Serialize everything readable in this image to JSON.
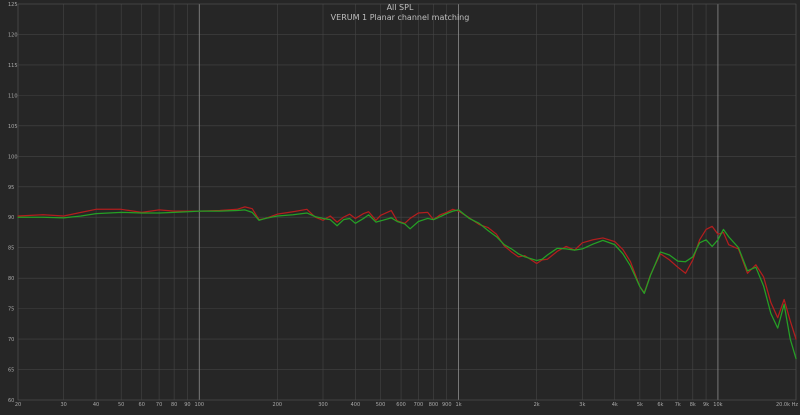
{
  "chart_data": {
    "type": "line",
    "title": "All SPL",
    "subtitle": "VERUM 1 Planar channel matching",
    "xlabel": "",
    "ylabel": "",
    "xscale": "log",
    "xlim": [
      20,
      20000
    ],
    "ylim": [
      60,
      125
    ],
    "grid": true,
    "legend": "none",
    "y_ticks": [
      60,
      65,
      70,
      75,
      80,
      85,
      90,
      95,
      100,
      105,
      110,
      115,
      120,
      125
    ],
    "y_tick_labels": [
      "60",
      "65",
      "70",
      "75",
      "80",
      "85",
      "90",
      "95",
      "100",
      "105",
      "110",
      "115",
      "120",
      "125"
    ],
    "x_ticks": [
      20,
      30,
      40,
      50,
      60,
      70,
      80,
      90,
      100,
      200,
      300,
      400,
      500,
      600,
      700,
      800,
      900,
      1000,
      2000,
      3000,
      4000,
      5000,
      6000,
      7000,
      8000,
      9000,
      10000,
      20000
    ],
    "x_tick_labels": [
      "20",
      "30",
      "40",
      "50",
      "60",
      "70",
      "80",
      "90",
      "100",
      "200",
      "300",
      "400",
      "500",
      "600",
      "700",
      "800",
      "900",
      "1k",
      "2k",
      "3k",
      "4k",
      "5k",
      "6k",
      "7k",
      "8k",
      "9k",
      "10k",
      "20.0k Hz"
    ],
    "major_x_lines": [
      100,
      1000,
      10000
    ],
    "series": [
      {
        "color": "#b31e1e",
        "points": [
          [
            20,
            90.2
          ],
          [
            25,
            90.4
          ],
          [
            30,
            90.2
          ],
          [
            35,
            90.8
          ],
          [
            40,
            91.3
          ],
          [
            50,
            91.3
          ],
          [
            60,
            90.8
          ],
          [
            70,
            91.2
          ],
          [
            80,
            91.0
          ],
          [
            90,
            91.0
          ],
          [
            100,
            91.0
          ],
          [
            120,
            91.1
          ],
          [
            140,
            91.3
          ],
          [
            150,
            91.7
          ],
          [
            160,
            91.4
          ],
          [
            170,
            89.6
          ],
          [
            180,
            89.8
          ],
          [
            200,
            90.5
          ],
          [
            230,
            90.9
          ],
          [
            260,
            91.3
          ],
          [
            280,
            90.0
          ],
          [
            300,
            89.5
          ],
          [
            320,
            90.2
          ],
          [
            340,
            89.2
          ],
          [
            360,
            90.0
          ],
          [
            380,
            90.5
          ],
          [
            400,
            89.8
          ],
          [
            430,
            90.6
          ],
          [
            450,
            90.9
          ],
          [
            480,
            89.5
          ],
          [
            500,
            90.3
          ],
          [
            550,
            91.1
          ],
          [
            580,
            89.4
          ],
          [
            620,
            89.0
          ],
          [
            650,
            89.8
          ],
          [
            700,
            90.7
          ],
          [
            760,
            90.8
          ],
          [
            800,
            89.6
          ],
          [
            850,
            90.4
          ],
          [
            900,
            90.8
          ],
          [
            950,
            91.3
          ],
          [
            1000,
            91.0
          ],
          [
            1100,
            89.9
          ],
          [
            1200,
            88.8
          ],
          [
            1300,
            88.3
          ],
          [
            1400,
            87.2
          ],
          [
            1500,
            85.3
          ],
          [
            1600,
            84.3
          ],
          [
            1700,
            83.5
          ],
          [
            1800,
            83.7
          ],
          [
            2000,
            82.4
          ],
          [
            2100,
            83.0
          ],
          [
            2200,
            83.1
          ],
          [
            2400,
            84.4
          ],
          [
            2600,
            85.2
          ],
          [
            2800,
            84.6
          ],
          [
            3000,
            85.8
          ],
          [
            3300,
            86.3
          ],
          [
            3600,
            86.6
          ],
          [
            4000,
            86.0
          ],
          [
            4300,
            84.7
          ],
          [
            4600,
            82.7
          ],
          [
            5000,
            78.6
          ],
          [
            5200,
            77.6
          ],
          [
            5500,
            80.6
          ],
          [
            6000,
            84.0
          ],
          [
            6500,
            83.0
          ],
          [
            7000,
            81.8
          ],
          [
            7500,
            80.8
          ],
          [
            8000,
            83.0
          ],
          [
            8500,
            86.3
          ],
          [
            9000,
            88.0
          ],
          [
            9500,
            88.5
          ],
          [
            10000,
            87.2
          ],
          [
            10500,
            87.5
          ],
          [
            11000,
            85.5
          ],
          [
            12000,
            84.8
          ],
          [
            13000,
            80.8
          ],
          [
            14000,
            82.2
          ],
          [
            15000,
            80.2
          ],
          [
            16000,
            76.0
          ],
          [
            17000,
            73.5
          ],
          [
            18000,
            76.5
          ],
          [
            19000,
            73.0
          ],
          [
            20000,
            70.0
          ]
        ]
      },
      {
        "color": "#25a025",
        "points": [
          [
            20,
            90.0
          ],
          [
            25,
            90.0
          ],
          [
            30,
            89.9
          ],
          [
            35,
            90.2
          ],
          [
            40,
            90.6
          ],
          [
            50,
            90.8
          ],
          [
            60,
            90.7
          ],
          [
            70,
            90.7
          ],
          [
            80,
            90.8
          ],
          [
            90,
            90.9
          ],
          [
            100,
            91.0
          ],
          [
            120,
            91.0
          ],
          [
            140,
            91.1
          ],
          [
            150,
            91.2
          ],
          [
            160,
            90.8
          ],
          [
            170,
            89.5
          ],
          [
            180,
            89.8
          ],
          [
            200,
            90.2
          ],
          [
            230,
            90.4
          ],
          [
            260,
            90.7
          ],
          [
            280,
            90.1
          ],
          [
            300,
            89.8
          ],
          [
            320,
            89.6
          ],
          [
            340,
            88.6
          ],
          [
            360,
            89.6
          ],
          [
            380,
            89.8
          ],
          [
            400,
            89.0
          ],
          [
            430,
            89.8
          ],
          [
            450,
            90.4
          ],
          [
            480,
            89.2
          ],
          [
            500,
            89.4
          ],
          [
            550,
            89.9
          ],
          [
            580,
            89.3
          ],
          [
            620,
            88.9
          ],
          [
            650,
            88.1
          ],
          [
            700,
            89.3
          ],
          [
            760,
            89.8
          ],
          [
            800,
            89.6
          ],
          [
            850,
            90.1
          ],
          [
            900,
            90.6
          ],
          [
            950,
            91.0
          ],
          [
            1000,
            91.2
          ],
          [
            1100,
            89.8
          ],
          [
            1200,
            89.0
          ],
          [
            1300,
            87.8
          ],
          [
            1400,
            86.8
          ],
          [
            1500,
            85.5
          ],
          [
            1600,
            84.8
          ],
          [
            1700,
            84.0
          ],
          [
            1800,
            83.5
          ],
          [
            2000,
            82.9
          ],
          [
            2100,
            83.1
          ],
          [
            2200,
            83.8
          ],
          [
            2400,
            84.9
          ],
          [
            2600,
            84.8
          ],
          [
            2800,
            84.6
          ],
          [
            3000,
            84.8
          ],
          [
            3300,
            85.6
          ],
          [
            3600,
            86.2
          ],
          [
            4000,
            85.5
          ],
          [
            4300,
            84.0
          ],
          [
            4600,
            82.0
          ],
          [
            5000,
            78.6
          ],
          [
            5200,
            77.5
          ],
          [
            5500,
            80.5
          ],
          [
            6000,
            84.3
          ],
          [
            6500,
            83.8
          ],
          [
            7000,
            82.8
          ],
          [
            7500,
            82.7
          ],
          [
            8000,
            83.5
          ],
          [
            8500,
            85.8
          ],
          [
            9000,
            86.3
          ],
          [
            9500,
            85.2
          ],
          [
            10000,
            86.3
          ],
          [
            10500,
            88.0
          ],
          [
            11000,
            86.8
          ],
          [
            12000,
            85.0
          ],
          [
            13000,
            81.2
          ],
          [
            14000,
            81.8
          ],
          [
            15000,
            78.7
          ],
          [
            16000,
            74.2
          ],
          [
            17000,
            71.8
          ],
          [
            18000,
            75.7
          ],
          [
            19000,
            70.0
          ],
          [
            20000,
            66.8
          ]
        ]
      }
    ]
  }
}
